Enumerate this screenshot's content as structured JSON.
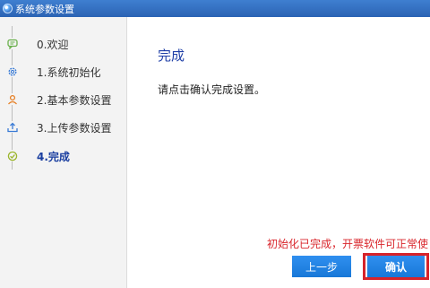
{
  "window": {
    "title": "系统参数设置"
  },
  "steps": [
    {
      "label": "0.欢迎",
      "icon": "chat-icon",
      "color": "#6ab04c",
      "active": false
    },
    {
      "label": "1.系统初始化",
      "icon": "gear-icon",
      "color": "#3a7bd5",
      "active": false
    },
    {
      "label": "2.基本参数设置",
      "icon": "person-icon",
      "color": "#e67e22",
      "active": false
    },
    {
      "label": "3.上传参数设置",
      "icon": "upload-icon",
      "color": "#3a7bd5",
      "active": false
    },
    {
      "label": "4.完成",
      "icon": "check-icon",
      "color": "#9bb52b",
      "active": true
    }
  ],
  "main": {
    "title": "完成",
    "description": "请点击确认完成设置。",
    "notice": "初始化已完成，开票软件可正常使"
  },
  "buttons": {
    "prev_label": "上一步",
    "confirm_label": "确认"
  },
  "colors": {
    "accent": "#1878d8",
    "title_blue": "#1f3fa7",
    "notice_red": "#d9262c",
    "highlight_border": "#d6232a"
  }
}
